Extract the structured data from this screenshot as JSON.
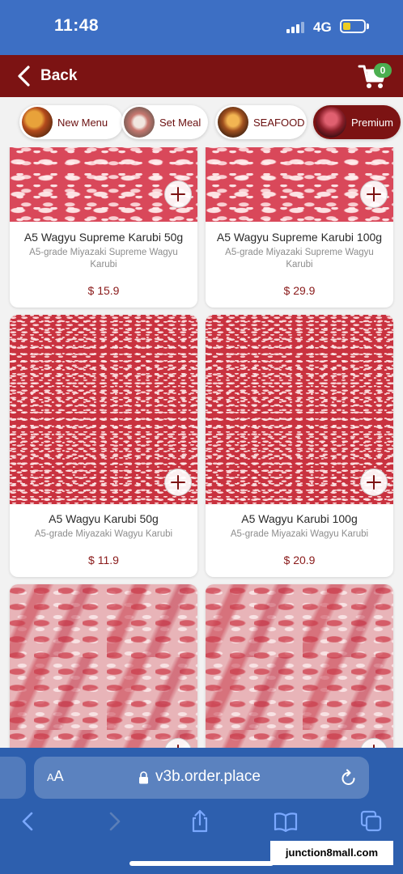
{
  "status_bar": {
    "time": "11:48",
    "network": "4G"
  },
  "header": {
    "back_label": "Back",
    "cart_count": "0"
  },
  "categories": [
    {
      "label": "New Menu",
      "active": false
    },
    {
      "label": "Set Meal",
      "active": false
    },
    {
      "label": "SEAFOOD",
      "active": false
    },
    {
      "label": "Premium",
      "active": true
    }
  ],
  "products": [
    {
      "name": "A5 Wagyu Supreme Karubi 50g",
      "description": "A5-grade Miyazaki Supreme Wagyu Karubi",
      "price": "$ 15.9"
    },
    {
      "name": "A5 Wagyu Supreme Karubi 100g",
      "description": "A5-grade Miyazaki Supreme Wagyu Karubi",
      "price": "$ 29.9"
    },
    {
      "name": "A5 Wagyu Karubi 50g",
      "description": "A5-grade Miyazaki Wagyu Karubi",
      "price": "$ 11.9"
    },
    {
      "name": "A5 Wagyu Karubi 100g",
      "description": "A5-grade Miyazaki Wagyu Karubi",
      "price": "$ 20.9"
    }
  ],
  "browser": {
    "aa_small": "A",
    "aa_large": "A",
    "url": "v3b.order.place"
  },
  "watermark": "junction8mall.com",
  "colors": {
    "header": "#7c1313",
    "status_bar": "#3d6fc4",
    "price": "#8a1a1a",
    "badge": "#4caf50"
  }
}
